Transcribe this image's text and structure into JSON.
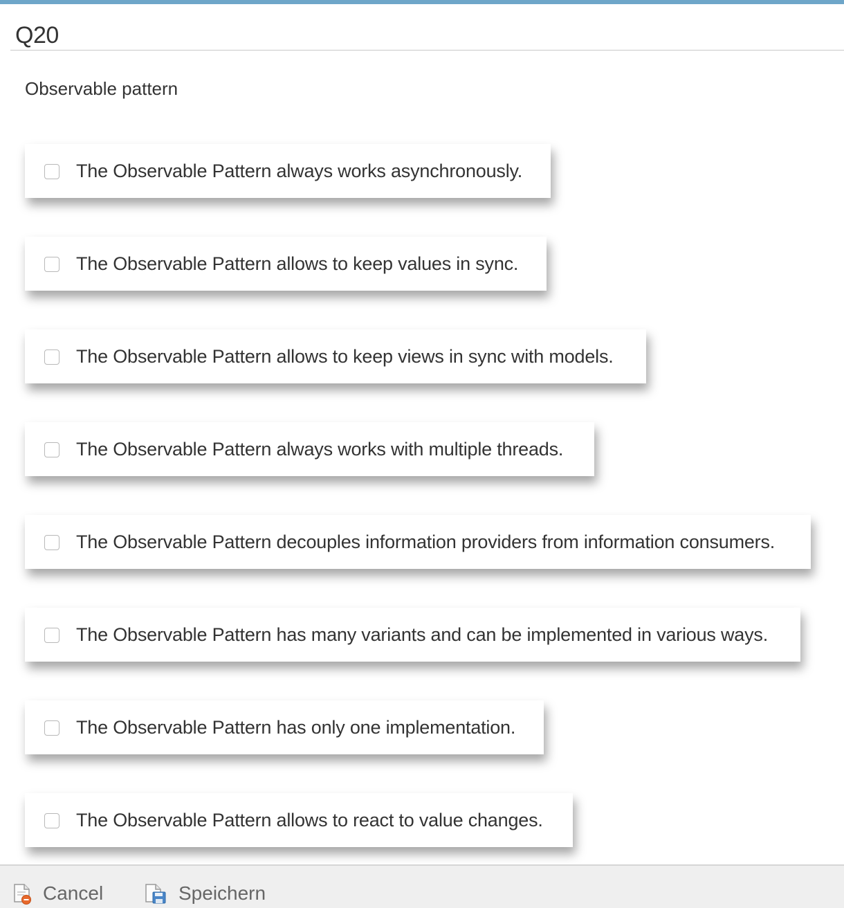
{
  "header": {
    "title": "Q20"
  },
  "question": {
    "text": "Observable pattern"
  },
  "options": [
    {
      "label": "The Observable Pattern always works asynchronously.",
      "checked": false
    },
    {
      "label": "The Observable Pattern allows to keep values in sync.",
      "checked": false
    },
    {
      "label": "The Observable Pattern allows to keep views in sync with models.",
      "checked": false
    },
    {
      "label": "The Observable Pattern always works with multiple threads.",
      "checked": false
    },
    {
      "label": "The Observable Pattern decouples information providers from information consumers.",
      "checked": false
    },
    {
      "label": "The Observable Pattern has many variants and can be implemented in various ways.",
      "checked": false
    },
    {
      "label": "The Observable Pattern has only one implementation.",
      "checked": false
    },
    {
      "label": "The Observable Pattern allows to react to value changes.",
      "checked": false
    }
  ],
  "footer": {
    "cancel_label": "Cancel",
    "cancel_icon": "cancel-document-icon",
    "save_label": "Speichern",
    "save_icon": "save-document-icon"
  },
  "colors": {
    "accent_bar": "#6ea6c9"
  }
}
